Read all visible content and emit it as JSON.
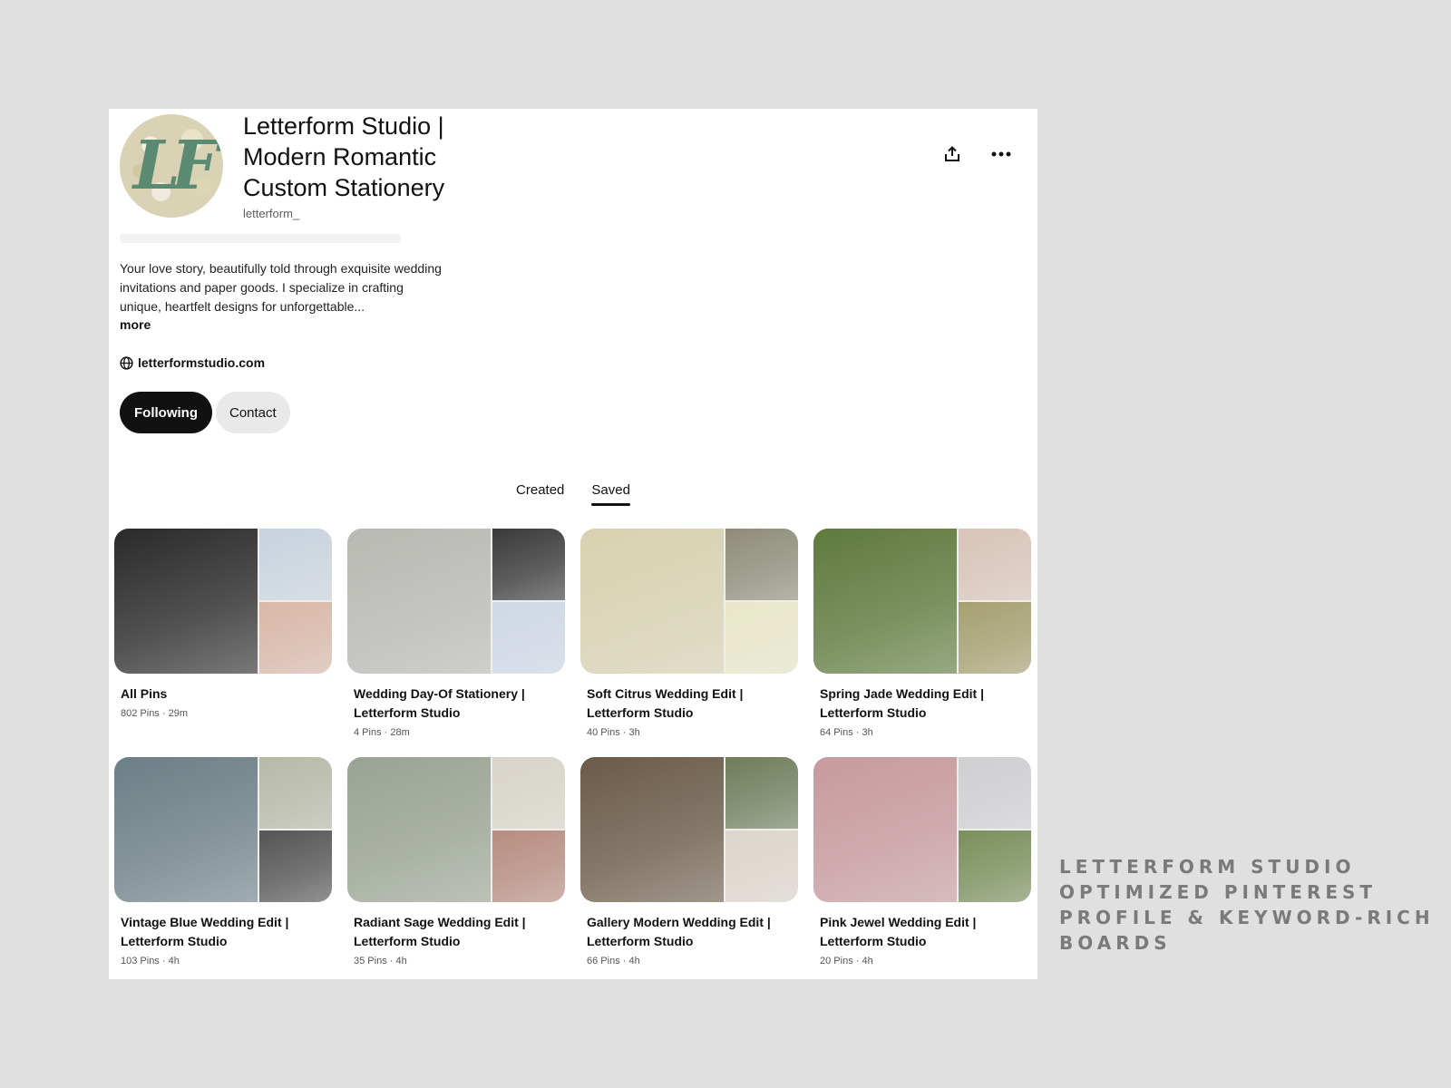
{
  "profile": {
    "title": "Letterform Studio | Modern Romantic Custom Stationery",
    "username": "letterform_",
    "bio": "Your love story, beautifully told through exquisite wedding invitations and paper goods. I specialize in crafting unique, heartfelt designs for unforgettable...",
    "more_label": "more",
    "website": "letterformstudio.com",
    "avatar_text": "LF",
    "following_label": "Following",
    "contact_label": "Contact"
  },
  "tabs": [
    {
      "label": "Created",
      "active": false
    },
    {
      "label": "Saved",
      "active": true
    }
  ],
  "boards": [
    {
      "title": "All Pins",
      "meta": "802 Pins · 29m",
      "colors": [
        "#2a2a2a",
        "#c9d3de",
        "#d9b8a8"
      ]
    },
    {
      "title": "Wedding Day-Of Stationery | Letterform Studio",
      "meta": "4 Pins · 28m",
      "colors": [
        "#b9b9b4",
        "#3a3a3a",
        "#cfd8e6"
      ]
    },
    {
      "title": "Soft Citrus Wedding Edit | Letterform Studio",
      "meta": "40 Pins · 3h",
      "colors": [
        "#d8d2b0",
        "#8f8d79",
        "#e8e7c8"
      ]
    },
    {
      "title": "Spring Jade Wedding Edit | Letterform Studio",
      "meta": "64 Pins · 3h",
      "colors": [
        "#5e7a3c",
        "#d9c4b8",
        "#a6a070"
      ]
    },
    {
      "title": "Vintage Blue Wedding Edit | Letterform Studio",
      "meta": "103 Pins · 4h",
      "colors": [
        "#6b7f86",
        "#b7b9a8",
        "#555555"
      ]
    },
    {
      "title": "Radiant Sage Wedding Edit | Letterform Studio",
      "meta": "35 Pins · 4h",
      "colors": [
        "#9aa393",
        "#d8d4c8",
        "#b78d80"
      ]
    },
    {
      "title": "Gallery Modern Wedding Edit | Letterform Studio",
      "meta": "66 Pins · 4h",
      "colors": [
        "#6b5b48",
        "#6f7d5b",
        "#dcd6cc"
      ]
    },
    {
      "title": "Pink Jewel Wedding Edit | Letterform Studio",
      "meta": "20 Pins · 4h",
      "colors": [
        "#c79a9e",
        "#cfcfd2",
        "#7a8f5c"
      ]
    }
  ],
  "caption": "LETTERFORM STUDIO OPTIMIZED PINTEREST PROFILE & KEYWORD-RICH BOARDS"
}
